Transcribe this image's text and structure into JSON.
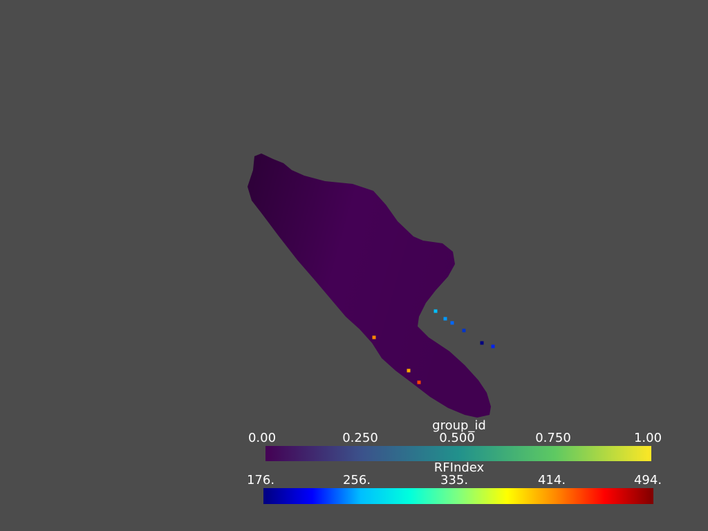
{
  "background_color": "#4c4c4c",
  "scene": {
    "surface_color": "#440154",
    "points": [
      {
        "color": "#00bfff"
      },
      {
        "color": "#0099ff"
      },
      {
        "color": "#0066ff"
      },
      {
        "color": "#0033cc"
      },
      {
        "color": "#00007f"
      },
      {
        "color": "#0022ee"
      },
      {
        "color": "#ff8800"
      },
      {
        "color": "#ffaa00"
      },
      {
        "color": "#ff4400"
      }
    ]
  },
  "scalar_bars": [
    {
      "title": "group_id",
      "ticks": [
        "0.00",
        "0.250",
        "0.500",
        "0.750",
        "1.00"
      ],
      "colormap": "viridis",
      "colors": [
        "#440154",
        "#3b528b",
        "#21918c",
        "#5ec962",
        "#fde725"
      ]
    },
    {
      "title": "RFIndex",
      "ticks": [
        "176.",
        "256.",
        "335.",
        "414.",
        "494."
      ],
      "colormap": "jet",
      "colors": [
        "#00007f",
        "#0000ff",
        "#00bfff",
        "#00ffdd",
        "#7fff7f",
        "#ffff00",
        "#ff8800",
        "#ff0000",
        "#7f0000"
      ]
    }
  ]
}
